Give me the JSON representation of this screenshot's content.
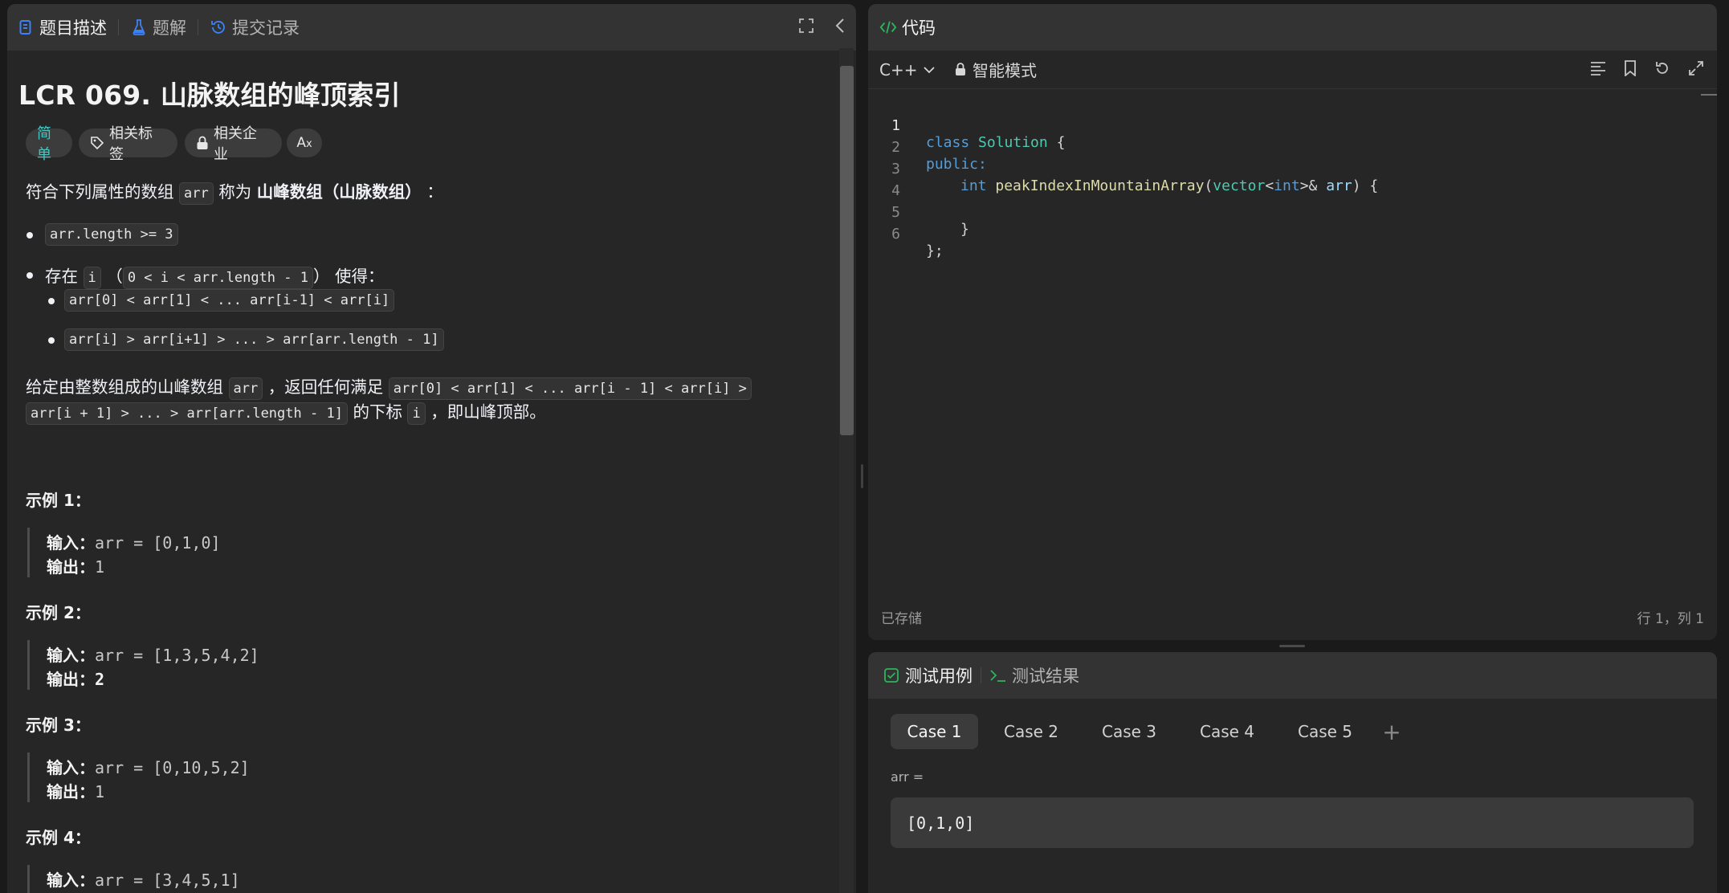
{
  "left_panel": {
    "tabs": [
      {
        "label": "题目描述",
        "icon": "description-icon"
      },
      {
        "label": "题解",
        "icon": "flask-icon"
      },
      {
        "label": "提交记录",
        "icon": "history-icon"
      }
    ],
    "title": "LCR 069. 山脉数组的峰顶索引",
    "pills": {
      "difficulty": "简单",
      "tags": "相关标签",
      "companies": "相关企业",
      "translate": "A̵x"
    },
    "intro": {
      "pre": "符合下列属性的数组 ",
      "code": "arr",
      "mid": " 称为 ",
      "bold": "山峰数组（山脉数组）",
      "post": " ："
    },
    "conditions": {
      "c1": "arr.length >= 3",
      "c2_pre": "存在 ",
      "c2_code1": "i",
      "c2_mid": " （",
      "c2_code2": "0 < i < arr.length - 1",
      "c2_post": "） 使得：",
      "sub1": "arr[0] < arr[1] < ... arr[i-1] < arr[i]",
      "sub2": "arr[i] > arr[i+1] > ... > arr[arr.length - 1]"
    },
    "task": {
      "pre": "给定由整数组成的山峰数组 ",
      "code1": "arr",
      "mid": " ，返回任何满足 ",
      "code2a": "arr[0] < arr[1] < ... arr[i - 1] < arr[i] >",
      "code2b": "arr[i + 1] > ... > arr[arr.length - 1]",
      "mid2": " 的下标 ",
      "code3": "i",
      "post": " ，即山峰顶部。"
    },
    "examples": [
      {
        "title": "示例 1：",
        "input_label": "输入：",
        "input": "arr = [0,1,0]",
        "output_label": "输出：",
        "output": "1"
      },
      {
        "title": "示例 2：",
        "input_label": "输入：",
        "input": "arr = [1,3,5,4,2]",
        "output_label": "输出：",
        "output": "2"
      },
      {
        "title": "示例 3：",
        "input_label": "输入：",
        "input": "arr = [0,10,5,2]",
        "output_label": "输出：",
        "output": "1"
      },
      {
        "title": "示例 4：",
        "input_label": "输入：",
        "input": "arr = [3,4,5,1]"
      }
    ]
  },
  "code_panel": {
    "title": "代码",
    "language": "C++",
    "mode": "智能模式",
    "line_numbers": [
      "1",
      "2",
      "3",
      "4",
      "5",
      "6"
    ],
    "code": {
      "l1_kw": "class",
      "l1_name": "Solution",
      "l1_rest": " {",
      "l2": "public:",
      "l3_type": "int",
      "l3_fn": "peakIndexInMountainArray",
      "l3_p1": "(",
      "l3_vec": "vector",
      "l3_lt": "<",
      "l3_int": "int",
      "l3_gt": ">&",
      "l3_arg": "arr",
      "l3_end": ") {",
      "l5": "}",
      "l6": "};"
    },
    "status_saved": "已存储",
    "cursor_pos": "行 1，列 1"
  },
  "test_panel": {
    "tabs": [
      {
        "label": "测试用例",
        "icon": "checkbox-icon"
      },
      {
        "label": "测试结果",
        "icon": "terminal-icon"
      }
    ],
    "cases": [
      "Case 1",
      "Case 2",
      "Case 3",
      "Case 4",
      "Case 5"
    ],
    "add": "+",
    "param_label": "arr =",
    "param_value": "[0,1,0]"
  },
  "colors": {
    "accent_green": "#2db55d",
    "accent_blue": "#3b82f6",
    "easy_teal": "#46c6c2"
  }
}
